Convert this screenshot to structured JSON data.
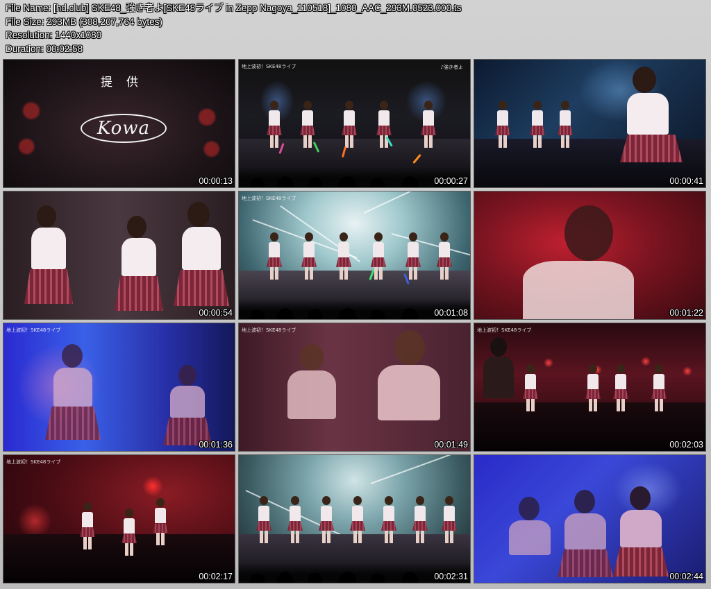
{
  "info": {
    "file_name": "File Name: [hd.club] SKE48_強き者よ[SKE48ライブ in Zepp Nagoya_110518]_1080_AAC_293M.0523.000.ts",
    "file_size": "File Size: 293MB (308,207,764 bytes)",
    "resolution": "Resolution: 1440x1080",
    "duration": "Duration: 00:02:58"
  },
  "sponsor": {
    "heading": "提供",
    "logo": "Kowa"
  },
  "channel_bug": "地上波初！SKE48ライブ",
  "song_bug": "♪強き者よ",
  "thumbnails": [
    {
      "timestamp": "00:00:13"
    },
    {
      "timestamp": "00:00:27"
    },
    {
      "timestamp": "00:00:41"
    },
    {
      "timestamp": "00:00:54"
    },
    {
      "timestamp": "00:01:08"
    },
    {
      "timestamp": "00:01:22"
    },
    {
      "timestamp": "00:01:36"
    },
    {
      "timestamp": "00:01:49"
    },
    {
      "timestamp": "00:02:03"
    },
    {
      "timestamp": "00:02:17"
    },
    {
      "timestamp": "00:02:31"
    },
    {
      "timestamp": "00:02:44"
    }
  ]
}
